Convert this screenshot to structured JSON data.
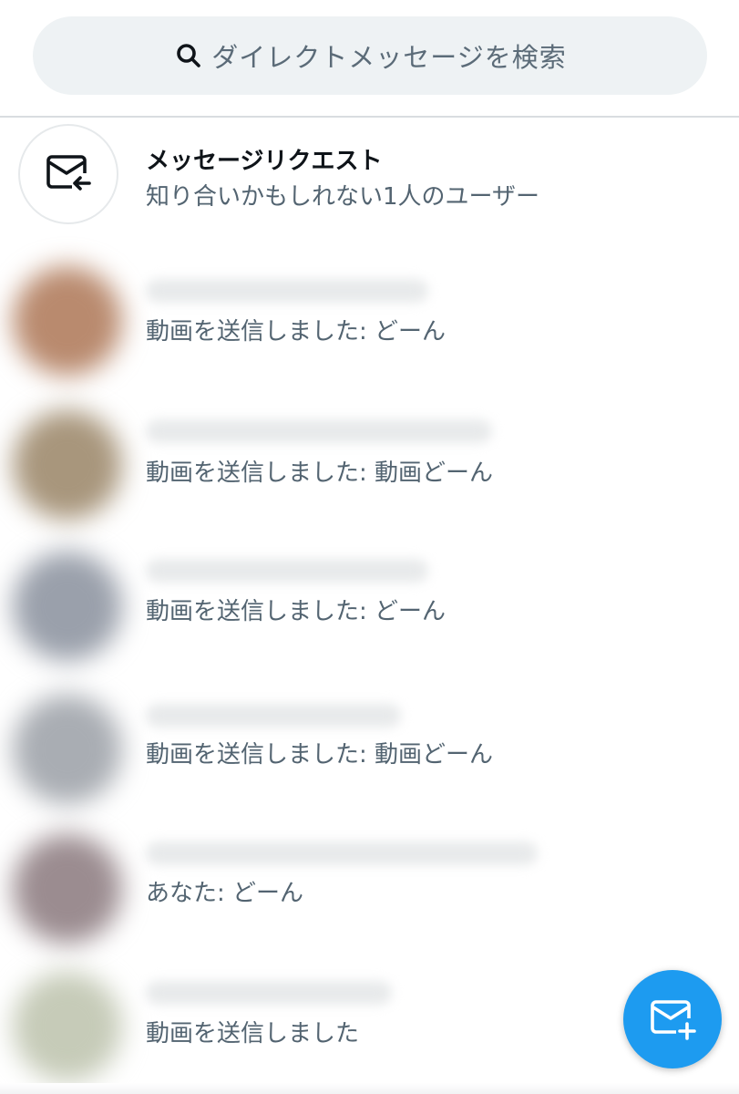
{
  "search": {
    "placeholder": "ダイレクトメッセージを検索",
    "icon": "search-icon"
  },
  "message_request": {
    "title": "メッセージリクエスト",
    "subtitle": "知り合いかもしれない1人のユーザー",
    "icon": "mail-inbox-icon"
  },
  "conversations": [
    {
      "preview": "動画を送信しました: どーん",
      "avatar_color": "#b98a6e"
    },
    {
      "preview": "動画を送信しました: 動画どーん",
      "avatar_color": "#a8967c"
    },
    {
      "preview": "動画を送信しました: どーん",
      "avatar_color": "#9aa0ab"
    },
    {
      "preview": "動画を送信しました: 動画どーん",
      "avatar_color": "#a9adb3"
    },
    {
      "preview": "あなた: どーん",
      "avatar_color": "#9b8c90"
    },
    {
      "preview": "動画を送信しました",
      "avatar_color": "#c6cbb8"
    }
  ],
  "compose": {
    "icon": "new-message-icon",
    "accent_color": "#1d9bf0"
  }
}
